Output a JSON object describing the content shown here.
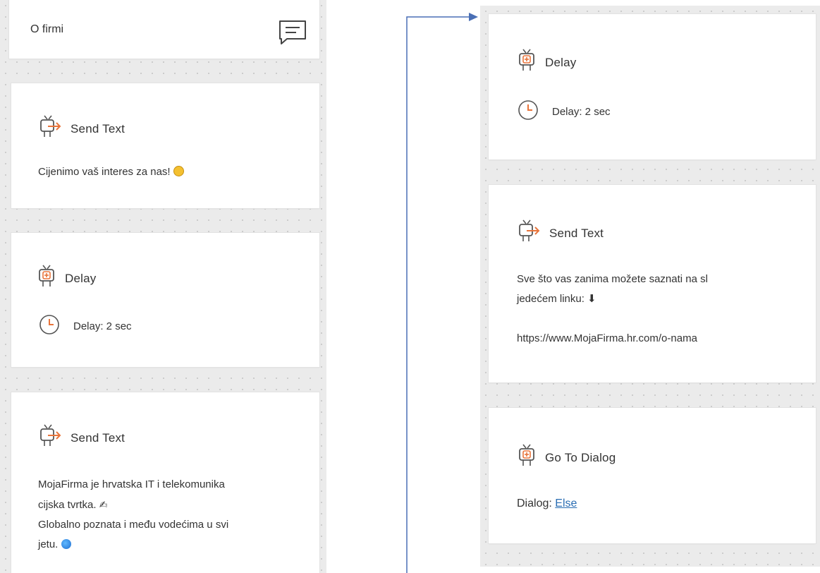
{
  "left_column": {
    "header": {
      "title": "O firmi",
      "icon": "comment-icon"
    },
    "cards": [
      {
        "type": "send-text",
        "title": "Send Text",
        "text": "Cijenimo vaš interes za nas!",
        "emoji": "smiling-face-emoji"
      },
      {
        "type": "delay",
        "title": "Delay",
        "delay_text": "Delay: 2 sec"
      },
      {
        "type": "send-text",
        "title": "Send Text",
        "line1": "MojaFirma je hrvatska IT i telekomunika",
        "line2": "cijska tvrtka.",
        "line3": "Globalno poznata i među vodećima u svi",
        "line4": "jetu."
      }
    ]
  },
  "right_column": {
    "cards": [
      {
        "type": "delay",
        "title": "Delay",
        "delay_text": "Delay: 2 sec"
      },
      {
        "type": "send-text",
        "title": "Send Text",
        "line1": "Sve što vas zanima možete saznati na sl",
        "line2": "jedećem linku: ⬇",
        "line3": "https://www.MojaFirma.hr.com/o-nama"
      },
      {
        "type": "go-to-dialog",
        "title": "Go To Dialog",
        "dialog_label": "Dialog:",
        "dialog_value": "Else"
      }
    ]
  },
  "colors": {
    "accent": "#e8743b",
    "icon_gray": "#555555",
    "connector": "#4a6fb5",
    "link": "#2a6db3",
    "canvas": "#ebebeb"
  }
}
